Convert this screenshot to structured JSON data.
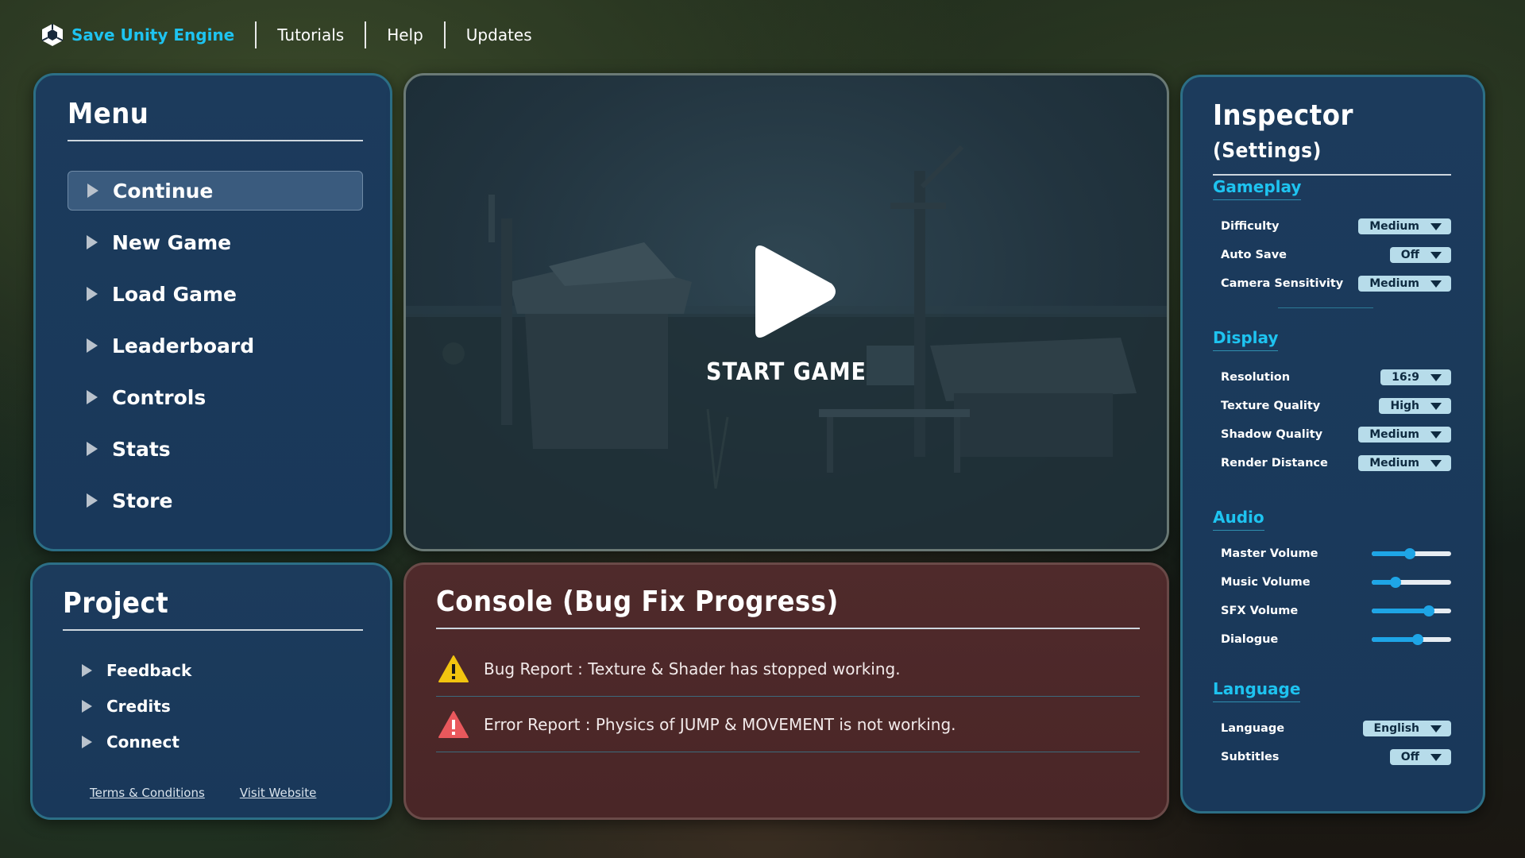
{
  "nav": {
    "brand": "Save Unity Engine",
    "links": [
      "Tutorials",
      "Help",
      "Updates"
    ]
  },
  "menu": {
    "title": "Menu",
    "items": [
      "Continue",
      "New Game",
      "Load Game",
      "Leaderboard",
      "Controls",
      "Stats",
      "Store"
    ],
    "active": "Continue"
  },
  "project": {
    "title": "Project",
    "items": [
      "Feedback",
      "Credits",
      "Connect"
    ],
    "links": [
      "Terms & Conditions",
      "Visit Website"
    ]
  },
  "game": {
    "start_label": "START GAME"
  },
  "console": {
    "title": "Console (Bug Fix Progress)",
    "logs": [
      {
        "type": "warning",
        "icon": "warning-icon",
        "color": "#f2c40f",
        "text": "Bug Report : Texture & Shader has stopped working."
      },
      {
        "type": "error",
        "icon": "error-icon",
        "color": "#e9585c",
        "text": "Error Report : Physics of JUMP & MOVEMENT is not working."
      }
    ]
  },
  "inspector": {
    "title": "Inspector",
    "title_suffix": "(Settings)",
    "gameplay": {
      "heading": "Gameplay",
      "difficulty_label": "Difficulty",
      "difficulty_value": "Medium",
      "autosave_label": "Auto Save",
      "autosave_value": "Off",
      "camera_label": "Camera Sensitivity",
      "camera_value": "Medium"
    },
    "display": {
      "heading": "Display",
      "resolution_label": "Resolution",
      "resolution_value": "16:9",
      "texture_label": "Texture Quality",
      "texture_value": "High",
      "shadow_label": "Shadow Quality",
      "shadow_value": "Medium",
      "render_label": "Render Distance",
      "render_value": "Medium"
    },
    "audio": {
      "heading": "Audio",
      "master_label": "Master Volume",
      "master_value": 0.48,
      "music_label": "Music Volume",
      "music_value": 0.3,
      "sfx_label": "SFX Volume",
      "sfx_value": 0.72,
      "dialogue_label": "Dialogue",
      "dialogue_value": 0.58
    },
    "language": {
      "heading": "Language",
      "language_label": "Language",
      "language_value": "English",
      "subtitles_label": "Subtitles",
      "subtitles_value": "Off"
    }
  },
  "colors": {
    "accent": "#1ec3f0",
    "panel_blue": "#1c3b5c",
    "console_red": "#4f2a2b",
    "slider": "#1ea5e6"
  }
}
